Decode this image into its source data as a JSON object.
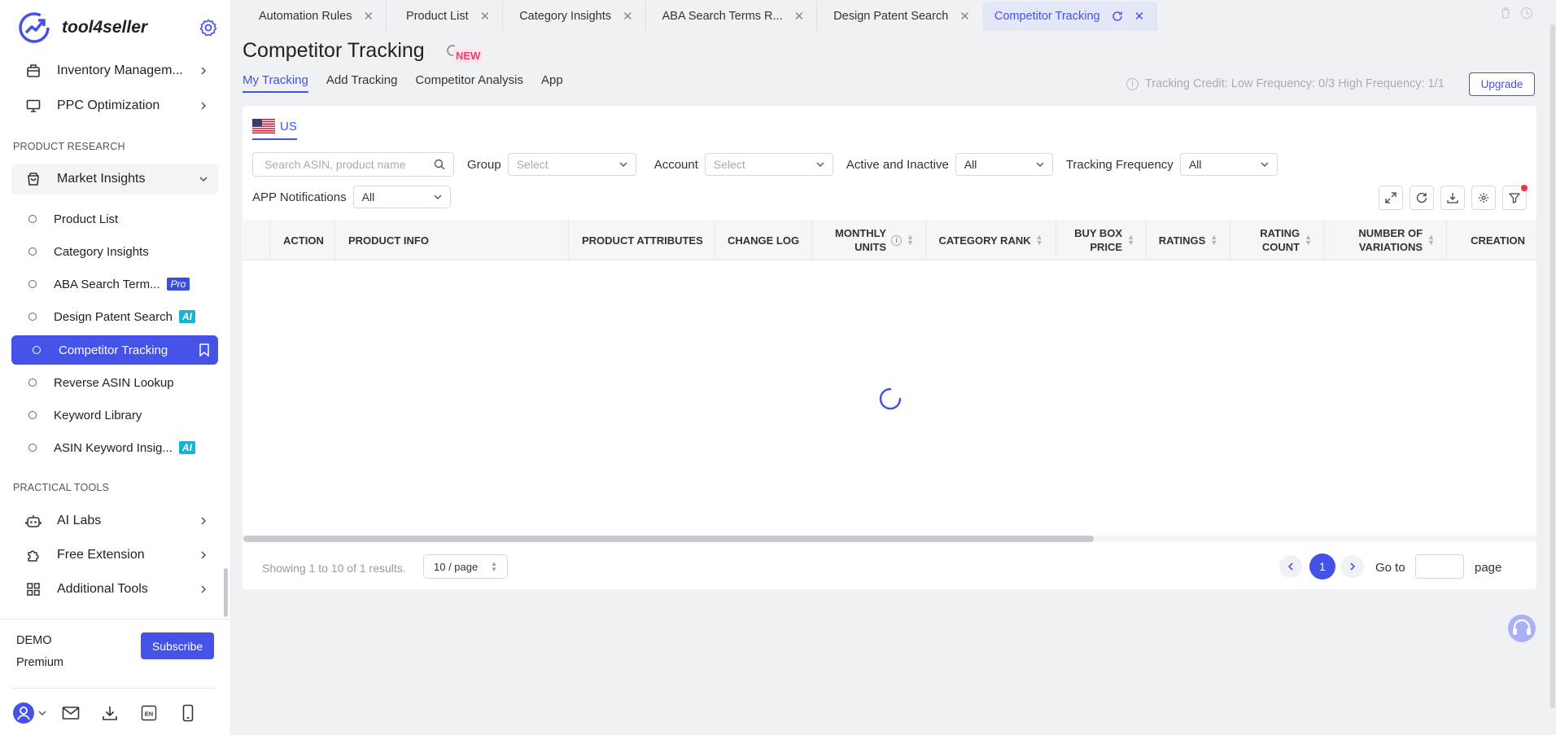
{
  "app": {
    "brand": "tool4seller"
  },
  "sidebar": {
    "top_items": [
      {
        "label": "Inventory Managem..."
      },
      {
        "label": "PPC Optimization"
      }
    ],
    "section_research": "PRODUCT RESEARCH",
    "market_insights": "Market Insights",
    "sub_items": [
      {
        "label": "Product List"
      },
      {
        "label": "Category Insights"
      },
      {
        "label": "ABA Search Term...",
        "badge": "Pro"
      },
      {
        "label": "Design Patent Search",
        "badge": "AI"
      },
      {
        "label": "Competitor Tracking"
      },
      {
        "label": "Reverse ASIN Lookup"
      },
      {
        "label": "Keyword Library"
      },
      {
        "label": "ASIN Keyword Insig...",
        "badge": "AI"
      }
    ],
    "section_tools": "PRACTICAL TOOLS",
    "tool_items": [
      {
        "label": "AI Labs"
      },
      {
        "label": "Free Extension"
      },
      {
        "label": "Additional Tools"
      }
    ],
    "account": {
      "name": "DEMO",
      "plan": "Premium",
      "subscribe": "Subscribe"
    }
  },
  "tabs": [
    {
      "label": "Automation Rules"
    },
    {
      "label": "Product List"
    },
    {
      "label": "Category Insights"
    },
    {
      "label": "ABA Search Terms R..."
    },
    {
      "label": "Design Patent Search"
    },
    {
      "label": "Competitor Tracking",
      "active": true
    }
  ],
  "page": {
    "title": "Competitor Tracking",
    "new_badge": "NEW",
    "subtabs": [
      "My Tracking",
      "Add Tracking",
      "Competitor Analysis",
      "App"
    ],
    "credit": "Tracking Credit: Low Frequency: 0/3 High Frequency: 1/1",
    "upgrade": "Upgrade"
  },
  "filters": {
    "market": "US",
    "search_placeholder": "Search ASIN, product name",
    "group_label": "Group",
    "group_value": "Select",
    "account_label": "Account",
    "account_value": "Select",
    "active_label": "Active and Inactive",
    "active_value": "All",
    "frequency_label": "Tracking Frequency",
    "frequency_value": "All",
    "notifications_label": "APP Notifications",
    "notifications_value": "All"
  },
  "table": {
    "columns": [
      {
        "label": "ACTION"
      },
      {
        "label": "PRODUCT INFO"
      },
      {
        "label": "PRODUCT ATTRIBUTES"
      },
      {
        "label": "CHANGE LOG"
      },
      {
        "label_1": "MONTHLY",
        "label_2": "UNITS"
      },
      {
        "label": "CATEGORY RANK"
      },
      {
        "label_1": "BUY BOX",
        "label_2": "PRICE"
      },
      {
        "label": "RATINGS"
      },
      {
        "label_1": "RATING",
        "label_2": "COUNT"
      },
      {
        "label_1": "NUMBER OF",
        "label_2": "VARIATIONS"
      },
      {
        "label": "CREATION"
      }
    ]
  },
  "pagination": {
    "showing": "Showing 1 to 10 of 1 results.",
    "per_page": "10 / page",
    "current": "1",
    "goto": "Go to",
    "page_word": "page"
  },
  "colors": {
    "accent": "#4552e8",
    "ai_badge": "#17b3d6",
    "new_badge": "#ef3f6b"
  }
}
